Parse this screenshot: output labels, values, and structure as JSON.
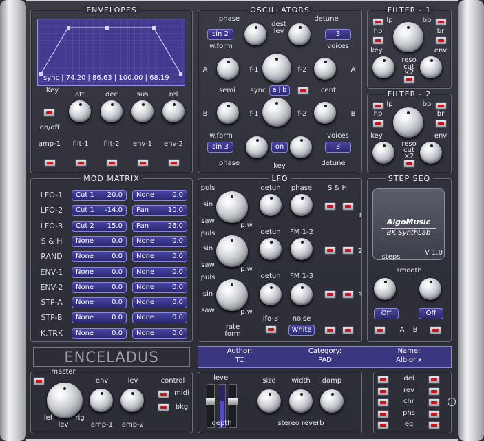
{
  "sections": {
    "envelopes": "ENVELOPES",
    "oscillators": "OSCILLATORS",
    "filter1": "FILTER - 1",
    "filter2": "FILTER - 2",
    "mod_matrix": "MOD MATRIX",
    "lfo": "LFO",
    "step_seq": "STEP SEQ"
  },
  "envelopes": {
    "display_text": "sync | 74.20 | 86.63 | 100.00 | 68.19",
    "key_label": "Key",
    "knob_labels": [
      "att",
      "dec",
      "sus",
      "rel"
    ],
    "onoff": "on/off",
    "targets": [
      "amp-1",
      "filt-1",
      "filt-2",
      "env-1",
      "env-2"
    ]
  },
  "osc": {
    "phase": "phase",
    "dest": "dest",
    "lev": "lev",
    "detune": "detune",
    "wform_val1": "sin 2",
    "wform": "w.form",
    "voices": "voices",
    "voices1": "3",
    "f1": "f-1",
    "f2": "f-2",
    "A": "A",
    "B": "B",
    "semi": "semi",
    "cent": "cent",
    "sync": "sync",
    "ab": "a | b",
    "wform_val2": "sin 3",
    "on": "on",
    "key": "key",
    "voices2": "3"
  },
  "filter": {
    "lp": "lp",
    "bp": "bp",
    "hp": "hp",
    "br": "br",
    "key": "key",
    "env": "env",
    "reso": "reso",
    "cut": "cut",
    "x2": "×2"
  },
  "mod_matrix": [
    {
      "src": "LFO-1",
      "d1": "Cut 1",
      "v1": "20.0",
      "d2": "None",
      "v2": "0.0"
    },
    {
      "src": "LFO-2",
      "d1": "Cut 1",
      "v1": "-14.0",
      "d2": "Pan",
      "v2": "10.0"
    },
    {
      "src": "LFO-3",
      "d1": "Cut 2",
      "v1": "15.0",
      "d2": "Pan",
      "v2": "26.0"
    },
    {
      "src": "S & H",
      "d1": "None",
      "v1": "0.0",
      "d2": "None",
      "v2": "0.0"
    },
    {
      "src": "RAND",
      "d1": "None",
      "v1": "0.0",
      "d2": "None",
      "v2": "0.0"
    },
    {
      "src": "ENV-1",
      "d1": "None",
      "v1": "0.0",
      "d2": "None",
      "v2": "0.0"
    },
    {
      "src": "ENV-2",
      "d1": "None",
      "v1": "0.0",
      "d2": "None",
      "v2": "0.0"
    },
    {
      "src": "STP-A",
      "d1": "None",
      "v1": "0.0",
      "d2": "None",
      "v2": "0.0"
    },
    {
      "src": "STP-B",
      "d1": "None",
      "v1": "0.0",
      "d2": "None",
      "v2": "0.0"
    },
    {
      "src": "K.TRK",
      "d1": "None",
      "v1": "0.0",
      "d2": "None",
      "v2": "0.0"
    }
  ],
  "lfo": {
    "puls": "puls",
    "sin": "sin",
    "saw": "saw",
    "pw": "p.w",
    "detun": "detun",
    "phase": "phase",
    "fm12": "FM 1-2",
    "fm13": "FM 1-3",
    "sh": "S & H",
    "rate": "rate",
    "form": "form",
    "lfo3": "lfo-3",
    "noise": "noise",
    "white": "White",
    "n1": "1",
    "n2": "2",
    "n3": "3"
  },
  "stepseq": {
    "brand": "AlgoMusic",
    "product": "BK SynthLab",
    "steps": "steps",
    "version": "V 1.0",
    "smooth": "smooth",
    "offA": "Off",
    "offB": "Off",
    "A": "A",
    "B": "B"
  },
  "patch": {
    "name": "ENCELADUS",
    "author_label": "Author:",
    "author": "TC",
    "category_label": "Category:",
    "category": "PAD",
    "name_label": "Name:",
    "name_val": "Albiorix"
  },
  "master": {
    "master": "master",
    "env": "env",
    "lev": "lev",
    "control": "control",
    "midi": "midi",
    "bkg": "bkg",
    "lef": "lef",
    "levb": "lev",
    "rig": "rig",
    "amp1": "amp-1",
    "amp2": "amp-2"
  },
  "fx": {
    "level": "level",
    "depth": "depth",
    "size": "size",
    "width": "width",
    "damp": "damp",
    "reverb": "stereo reverb",
    "items": [
      "del",
      "rev",
      "chr",
      "phs",
      "eq"
    ]
  }
}
